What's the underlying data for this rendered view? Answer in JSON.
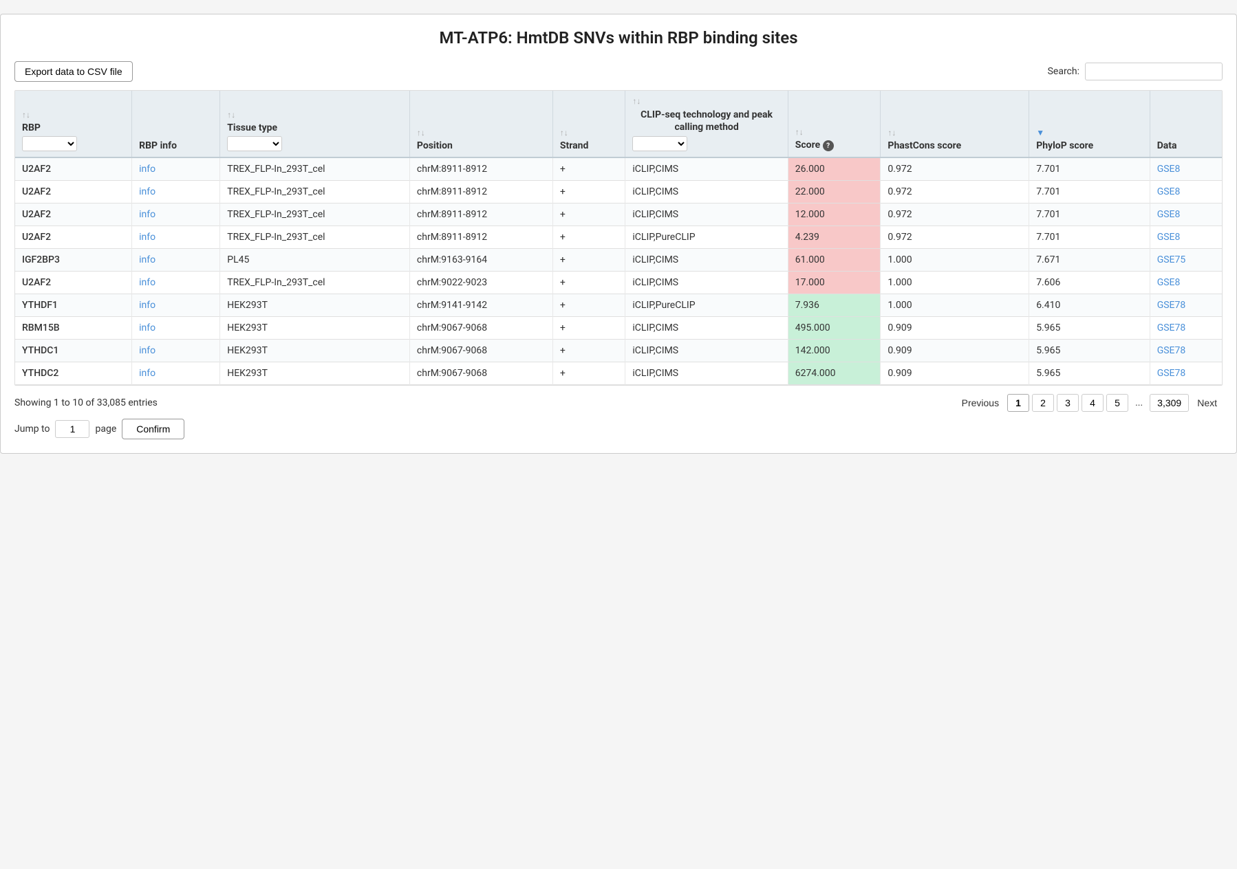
{
  "page": {
    "title": "MT-ATP6: HmtDB SNVs within RBP binding sites"
  },
  "toolbar": {
    "export_label": "Export data to CSV file",
    "search_label": "Search:",
    "search_value": ""
  },
  "table": {
    "columns": [
      {
        "key": "rbp",
        "label": "RBP",
        "has_dropdown": true,
        "has_sort": true
      },
      {
        "key": "rbp_info",
        "label": "RBP info",
        "has_dropdown": false,
        "has_sort": false
      },
      {
        "key": "tissue_type",
        "label": "Tissue type",
        "has_dropdown": true,
        "has_sort": true
      },
      {
        "key": "position",
        "label": "Position",
        "has_dropdown": false,
        "has_sort": true
      },
      {
        "key": "strand",
        "label": "Strand",
        "has_dropdown": false,
        "has_sort": true
      },
      {
        "key": "clip_seq",
        "label": "CLIP-seq technology and peak calling method",
        "has_dropdown": true,
        "has_sort": true
      },
      {
        "key": "score",
        "label": "Score",
        "has_help": true,
        "has_dropdown": false,
        "has_sort": true
      },
      {
        "key": "phastcons",
        "label": "PhastCons score",
        "has_dropdown": false,
        "has_sort": true
      },
      {
        "key": "phylop",
        "label": "PhyloP score",
        "has_dropdown": false,
        "has_sort": true,
        "active_sort": true
      },
      {
        "key": "data",
        "label": "Data",
        "has_dropdown": false,
        "has_sort": false
      }
    ],
    "rows": [
      {
        "rbp": "U2AF2",
        "rbp_info": "info",
        "tissue_type": "TREX_FLP-In_293T_cel",
        "position": "chrM:8911-8912",
        "strand": "+",
        "clip_seq": "iCLIP,CIMS",
        "score": "26.000",
        "phastcons": "0.972",
        "phylop": "7.701",
        "data": "GSE8",
        "score_class": "pink"
      },
      {
        "rbp": "U2AF2",
        "rbp_info": "info",
        "tissue_type": "TREX_FLP-In_293T_cel",
        "position": "chrM:8911-8912",
        "strand": "+",
        "clip_seq": "iCLIP,CIMS",
        "score": "22.000",
        "phastcons": "0.972",
        "phylop": "7.701",
        "data": "GSE8",
        "score_class": "pink"
      },
      {
        "rbp": "U2AF2",
        "rbp_info": "info",
        "tissue_type": "TREX_FLP-In_293T_cel",
        "position": "chrM:8911-8912",
        "strand": "+",
        "clip_seq": "iCLIP,CIMS",
        "score": "12.000",
        "phastcons": "0.972",
        "phylop": "7.701",
        "data": "GSE8",
        "score_class": "pink"
      },
      {
        "rbp": "U2AF2",
        "rbp_info": "info",
        "tissue_type": "TREX_FLP-In_293T_cel",
        "position": "chrM:8911-8912",
        "strand": "+",
        "clip_seq": "iCLIP,PureCLIP",
        "score": "4.239",
        "phastcons": "0.972",
        "phylop": "7.701",
        "data": "GSE8",
        "score_class": "pink"
      },
      {
        "rbp": "IGF2BP3",
        "rbp_info": "info",
        "tissue_type": "PL45",
        "position": "chrM:9163-9164",
        "strand": "+",
        "clip_seq": "iCLIP,CIMS",
        "score": "61.000",
        "phastcons": "1.000",
        "phylop": "7.671",
        "data": "GSE75",
        "score_class": "pink"
      },
      {
        "rbp": "U2AF2",
        "rbp_info": "info",
        "tissue_type": "TREX_FLP-In_293T_cel",
        "position": "chrM:9022-9023",
        "strand": "+",
        "clip_seq": "iCLIP,CIMS",
        "score": "17.000",
        "phastcons": "1.000",
        "phylop": "7.606",
        "data": "GSE8",
        "score_class": "pink"
      },
      {
        "rbp": "YTHDF1",
        "rbp_info": "info",
        "tissue_type": "HEK293T",
        "position": "chrM:9141-9142",
        "strand": "+",
        "clip_seq": "iCLIP,PureCLIP",
        "score": "7.936",
        "phastcons": "1.000",
        "phylop": "6.410",
        "data": "GSE78",
        "score_class": "green"
      },
      {
        "rbp": "RBM15B",
        "rbp_info": "info",
        "tissue_type": "HEK293T",
        "position": "chrM:9067-9068",
        "strand": "+",
        "clip_seq": "iCLIP,CIMS",
        "score": "495.000",
        "phastcons": "0.909",
        "phylop": "5.965",
        "data": "GSE78",
        "score_class": "green"
      },
      {
        "rbp": "YTHDC1",
        "rbp_info": "info",
        "tissue_type": "HEK293T",
        "position": "chrM:9067-9068",
        "strand": "+",
        "clip_seq": "iCLIP,CIMS",
        "score": "142.000",
        "phastcons": "0.909",
        "phylop": "5.965",
        "data": "GSE78",
        "score_class": "green"
      },
      {
        "rbp": "YTHDC2",
        "rbp_info": "info",
        "tissue_type": "HEK293T",
        "position": "chrM:9067-9068",
        "strand": "+",
        "clip_seq": "iCLIP,CIMS",
        "score": "6274.000",
        "phastcons": "0.909",
        "phylop": "5.965",
        "data": "GSE78",
        "score_class": "green"
      }
    ]
  },
  "footer": {
    "showing_text": "Showing 1 to 10 of 33,085 entries",
    "previous_label": "Previous",
    "next_label": "Next",
    "pages": [
      "1",
      "2",
      "3",
      "4",
      "5",
      "...",
      "3,309"
    ],
    "active_page": "1",
    "jump_label": "Jump to",
    "jump_value": "1",
    "page_label": "page",
    "confirm_label": "Confirm"
  }
}
